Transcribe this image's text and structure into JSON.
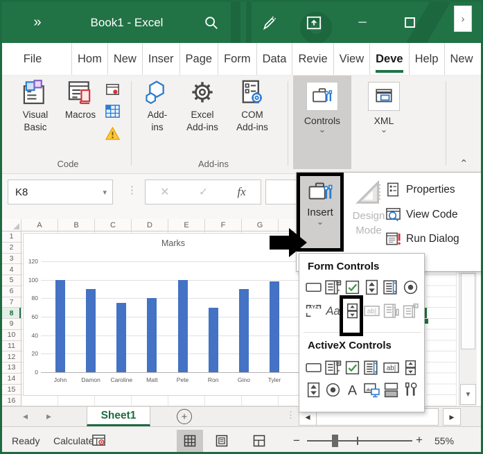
{
  "window": {
    "title": "Book1  -  Excel"
  },
  "glyphs": {
    "app_more": "»",
    "chevron_down": "⌄",
    "collapse": "⌃",
    "overflow": "›",
    "dropdown": "▾",
    "dots": "⋮",
    "cancel": "✕",
    "enter": "✓",
    "fx": "fx",
    "minimize": "─",
    "close": "✕",
    "tab_prev": "◂",
    "tab_next": "▸",
    "scroll_left": "◂",
    "scroll_right": "▸",
    "scroll_down": "▼",
    "zoom_minus": "−",
    "zoom_plus": "+",
    "add_sheet": "+"
  },
  "tabs": {
    "items": [
      {
        "label": "File"
      },
      {
        "label": "Hom"
      },
      {
        "label": "New"
      },
      {
        "label": "Inser"
      },
      {
        "label": "Page"
      },
      {
        "label": "Form"
      },
      {
        "label": "Data"
      },
      {
        "label": "Revie"
      },
      {
        "label": "View"
      },
      {
        "label": "Deve",
        "active": true
      },
      {
        "label": "Help"
      },
      {
        "label": "New"
      }
    ]
  },
  "ribbon": {
    "code": {
      "label": "Code",
      "visual_basic": [
        "Visual",
        "Basic"
      ],
      "macros": "Macros"
    },
    "addins": {
      "label": "Add-ins",
      "item1": [
        "Add-",
        "ins"
      ],
      "item2": [
        "Excel",
        "Add-ins"
      ],
      "item3": [
        "COM",
        "Add-ins"
      ]
    },
    "controls": {
      "label": "Controls"
    },
    "xml": {
      "label": "XML"
    }
  },
  "flyout": {
    "insert": "Insert",
    "design": [
      "Design",
      "Mode"
    ],
    "menu": [
      {
        "label": "Properties"
      },
      {
        "label": "View Code"
      },
      {
        "label": "Run Dialog"
      }
    ]
  },
  "dropdown": {
    "form_title": "Form Controls",
    "activex_title": "ActiveX Controls",
    "form_rows": [
      [
        {
          "icon": "button",
          "name": "form-button"
        },
        {
          "icon": "combo",
          "name": "form-combo-box"
        },
        {
          "icon": "checkbox",
          "name": "form-check-box"
        },
        {
          "icon": "spin",
          "name": "form-spin-button"
        },
        {
          "icon": "listbox",
          "name": "form-list-box"
        },
        {
          "icon": "option",
          "name": "form-option-button"
        }
      ],
      [
        {
          "icon": "groupbox",
          "name": "form-group-box"
        },
        {
          "icon": "labeltext",
          "name": "form-label"
        },
        {
          "icon": "scrollbtns",
          "name": "form-scroll-bar",
          "boxed": true
        },
        {
          "icon": "textfield",
          "name": "form-text-field",
          "disabled": true
        },
        {
          "icon": "combolist",
          "name": "form-combo-list-edit",
          "disabled": true
        },
        {
          "icon": "combodd",
          "name": "form-combo-dropdown-edit",
          "disabled": true
        }
      ]
    ],
    "activex_rows": [
      [
        {
          "icon": "button",
          "name": "activex-command-button"
        },
        {
          "icon": "combo",
          "name": "activex-combo-box"
        },
        {
          "icon": "checkbox",
          "name": "activex-check-box"
        },
        {
          "icon": "listbox",
          "name": "activex-list-box"
        },
        {
          "icon": "textfield",
          "name": "activex-text-box"
        },
        {
          "icon": "scrollbtns",
          "name": "activex-spin-button"
        }
      ],
      [
        {
          "icon": "spin",
          "name": "activex-scroll-bar"
        },
        {
          "icon": "option",
          "name": "activex-option-button"
        },
        {
          "icon": "labela",
          "name": "activex-label"
        },
        {
          "icon": "image",
          "name": "activex-image"
        },
        {
          "icon": "toggle",
          "name": "activex-toggle-button"
        },
        {
          "icon": "tools",
          "name": "activex-more-controls"
        }
      ]
    ]
  },
  "formula": {
    "name_box": "K8"
  },
  "grid": {
    "columns": [
      "A",
      "B",
      "C",
      "D",
      "E",
      "F",
      "G"
    ],
    "rows": [
      "1",
      "2",
      "3",
      "4",
      "5",
      "6",
      "7",
      "8",
      "9",
      "10",
      "11",
      "12",
      "13",
      "14",
      "15",
      "16"
    ],
    "active_row": "8"
  },
  "chart_data": {
    "type": "bar",
    "title": "Marks",
    "categories": [
      "John",
      "Damon",
      "Caroline",
      "Matt",
      "Pete",
      "Ron",
      "Gino",
      "Tyler"
    ],
    "values": [
      100,
      90,
      75,
      80,
      100,
      70,
      90,
      98
    ],
    "xlabel": "",
    "ylabel": "",
    "ylim": [
      0,
      120
    ],
    "ytick_step": 20,
    "bar_color": "#4472c4",
    "grid": true,
    "legend": "none"
  },
  "sheet_bar": {
    "tab": "Sheet1"
  },
  "status": {
    "ready": "Ready",
    "calculate": "Calculate",
    "zoom": "55%"
  }
}
